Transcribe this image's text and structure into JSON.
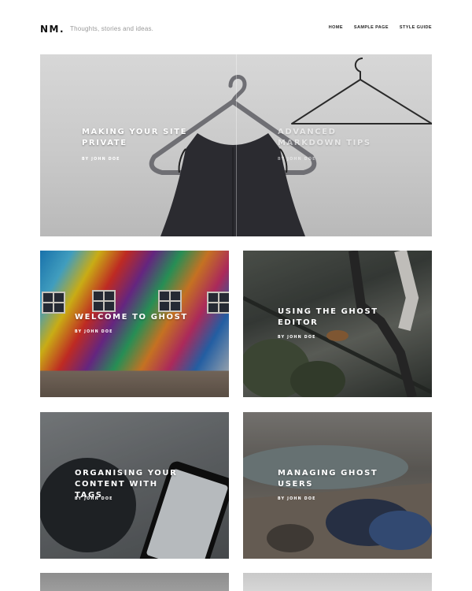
{
  "site": {
    "logo": "NM.",
    "tagline": "Thoughts, stories and ideas."
  },
  "nav": {
    "items": [
      "HOME",
      "SAMPLE PAGE",
      "STYLE GUIDE"
    ]
  },
  "hero": {
    "left": {
      "title": "MAKING YOUR SITE PRIVATE",
      "author": "BY JOHN DOE"
    },
    "right": {
      "title": "ADVANCED MARKDOWN TIPS",
      "author": "BY JOHN DOE"
    }
  },
  "posts": [
    {
      "title": "WELCOME TO GHOST",
      "author": "BY JOHN DOE"
    },
    {
      "title": "USING THE GHOST EDITOR",
      "author": "BY JOHN DOE"
    },
    {
      "title": "ORGANISING YOUR CONTENT WITH TAGS",
      "author": "BY JOHN DOE"
    },
    {
      "title": "MANAGING GHOST USERS",
      "author": "BY JOHN DOE"
    }
  ],
  "colors": {
    "text": "#111111",
    "muted": "#9a9a9a",
    "overlay_text": "#ffffff"
  }
}
